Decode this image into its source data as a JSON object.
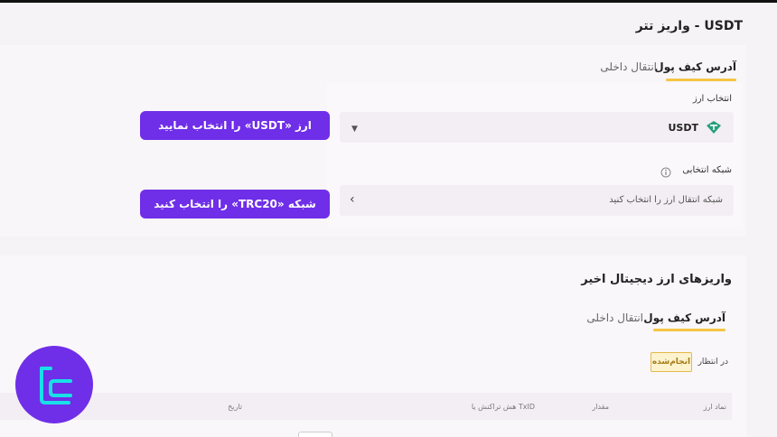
{
  "header": {
    "title": "واریز تتر - USDT"
  },
  "deposit_form": {
    "tabs": [
      {
        "label": "آدرس کیف پول",
        "active": true
      },
      {
        "label": "انتقال داخلی",
        "active": false
      }
    ],
    "currency_label": "انتخاب ارز",
    "currency_value": "USDT",
    "currency_icon": "tether-icon",
    "network_label": "شبکه انتخابی",
    "network_placeholder": "شبکه انتقال ارز را انتخاب کنید"
  },
  "callouts": {
    "select_currency": "ارز «USDT» را انتخاب نمایید",
    "select_network": "شبکه «TRC20» را انتخاب کنید"
  },
  "recent": {
    "title": "واریزهای ارز دیجیتال اخیر",
    "tabs": [
      {
        "label": "آدرس کیف پول",
        "active": true
      },
      {
        "label": "انتقال داخلی",
        "active": false
      }
    ],
    "status_filters": [
      "در انتظار",
      "انجام‌شده"
    ],
    "table_columns": [
      "نماد ارز",
      "مقدار",
      "هش تراکنش یا TxID",
      "تاریخ"
    ]
  },
  "colors": {
    "accent": "#f4c542",
    "callout_bg": "#6f2ee8",
    "tether": "#26a17b"
  }
}
